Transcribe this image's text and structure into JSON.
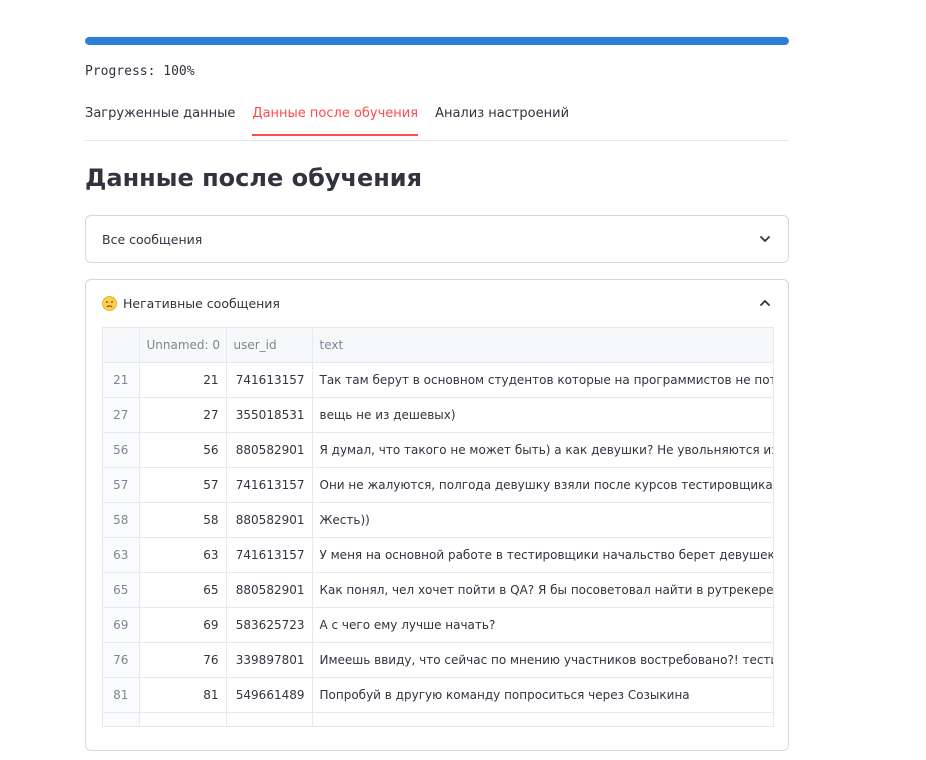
{
  "progress": {
    "value": 1.0,
    "text": "Progress: 100%",
    "bar_color": "#2c7fd9"
  },
  "tabs": [
    {
      "label": "Загруженные данные",
      "active": false
    },
    {
      "label": "Данные после обучения",
      "active": true
    },
    {
      "label": "Анализ настроений",
      "active": false
    }
  ],
  "accent_color": "#ff4b4b",
  "page_title": "Данные после обучения",
  "expanders": {
    "all": {
      "label": "Все сообщения",
      "expanded": false,
      "icon": "chevron-down-icon"
    },
    "negative": {
      "label": "Негативные сообщения",
      "expanded": true,
      "icon": "chevron-up-icon",
      "emoji": "slightly-frowning-face-icon"
    }
  },
  "table": {
    "columns": [
      "",
      "Unnamed: 0",
      "user_id",
      "text"
    ],
    "rows": [
      [
        "21",
        "21",
        "741613157",
        "Так там берут в основном студентов которые на программистов не потянут"
      ],
      [
        "27",
        "27",
        "355018531",
        "вещь не из дешевых)"
      ],
      [
        "56",
        "56",
        "880582901",
        "Я думал, что такого не может быть) а как девушки? Не увольняются из-за этого?"
      ],
      [
        "57",
        "57",
        "741613157",
        "Они не жалуются, полгода девушку взяли после курсов тестировщика она"
      ],
      [
        "58",
        "58",
        "880582901",
        "Жесть))"
      ],
      [
        "63",
        "63",
        "741613157",
        "У меня на основной работе в тестировщики начальство берет девушек до"
      ],
      [
        "65",
        "65",
        "880582901",
        "Как понял, чел хочет пойти в QA?  Я бы посоветовал найти в рутрекере или"
      ],
      [
        "69",
        "69",
        "583625723",
        "А с чего ему лучше начать?"
      ],
      [
        "76",
        "76",
        "339897801",
        "Имеешь ввиду, что сейчас по мнению участников востребовано?! тестиров"
      ],
      [
        "81",
        "81",
        "549661489",
        "Попробуй в другую команду попроситься через Созыкина"
      ],
      [
        "",
        "",
        "",
        ""
      ]
    ]
  }
}
